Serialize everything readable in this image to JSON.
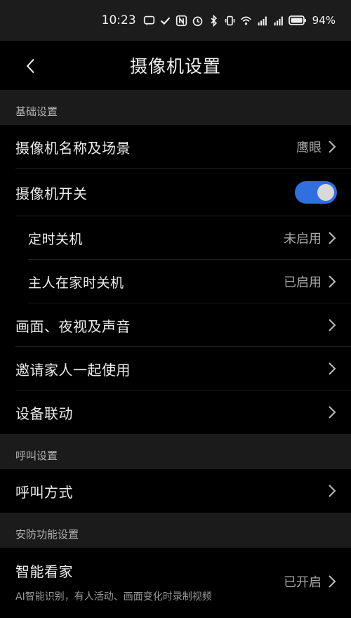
{
  "status_bar": {
    "time": "10:23",
    "battery": "94%",
    "network_1": "4G",
    "network_2": "5G"
  },
  "nav": {
    "title": "摄像机设置"
  },
  "sections": {
    "basic": "基础设置",
    "call": "呼叫设置",
    "security": "安防功能设置"
  },
  "rows": {
    "camera_name": {
      "label": "摄像机名称及场景",
      "value": "鹰眼"
    },
    "camera_switch": {
      "label": "摄像机开关",
      "enabled": true
    },
    "scheduled_off": {
      "label": "定时关机",
      "value": "未启用"
    },
    "home_off": {
      "label": "主人在家时关机",
      "value": "已启用"
    },
    "picture": {
      "label": "画面、夜视及声音"
    },
    "invite": {
      "label": "邀请家人一起使用"
    },
    "linkage": {
      "label": "设备联动"
    },
    "call_mode": {
      "label": "呼叫方式"
    },
    "smart_watch": {
      "label": "智能看家",
      "value": "已开启",
      "desc": "AI智能识别，有人活动、画面变化时录制视频"
    }
  },
  "colors": {
    "toggle_on": "#2f6fdf",
    "section_bg": "#1b1b1b",
    "status_bg": "#1c1c1c"
  }
}
